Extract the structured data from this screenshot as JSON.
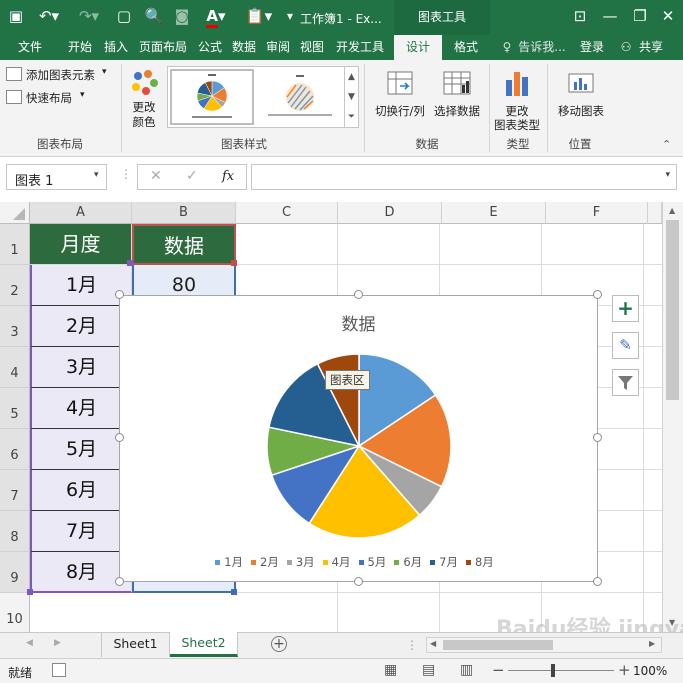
{
  "titlebar": {
    "title": "工作簿1 - Ex...",
    "context_title": "图表工具"
  },
  "tabs": [
    "文件",
    "开始",
    "插入",
    "页面布局",
    "公式",
    "数据",
    "审阅",
    "视图",
    "开发工具",
    "设计",
    "格式"
  ],
  "tell_me": "告诉我...",
  "signin": "登录",
  "share": "共享",
  "ribbon": {
    "add_element": "添加图表元素",
    "quick_layout": "快速布局",
    "change_colors_1": "更改",
    "change_colors_2": "颜色",
    "switch_row_col": "切换行/列",
    "select_data": "选择数据",
    "change_type_1": "更改",
    "change_type_2": "图表类型",
    "move_chart": "移动图表",
    "groups": {
      "layout": "图表布局",
      "styles": "图表样式",
      "data": "数据",
      "type": "类型",
      "location": "位置"
    }
  },
  "namebox": "图表 1",
  "fx": "fx",
  "columns": [
    "A",
    "B",
    "C",
    "D",
    "E",
    "F"
  ],
  "rows": [
    "1",
    "2",
    "3",
    "4",
    "5",
    "6",
    "7",
    "8",
    "9",
    "10"
  ],
  "table": {
    "header_a": "月度",
    "header_b": "数据",
    "months": [
      "1月",
      "2月",
      "3月",
      "4月",
      "5月",
      "6月",
      "7月",
      "8月"
    ],
    "b2": "80"
  },
  "chart_data": {
    "type": "pie",
    "title": "数据",
    "categories": [
      "1月",
      "2月",
      "3月",
      "4月",
      "5月",
      "6月",
      "7月",
      "8月"
    ],
    "values": [
      80,
      85,
      32,
      105,
      55,
      43,
      73,
      38
    ],
    "colors": [
      "#5b9bd5",
      "#ed7d31",
      "#a5a5a5",
      "#ffc000",
      "#4472c4",
      "#70ad47",
      "#255e91",
      "#9e480e"
    ],
    "legend_position": "bottom",
    "tooltip": "图表区"
  },
  "sheets": [
    "Sheet1",
    "Sheet2"
  ],
  "active_sheet": "Sheet2",
  "status": {
    "ready": "就绪",
    "zoom": "100%"
  },
  "watermark": "Baidu经验 jingyan.baidu.com"
}
